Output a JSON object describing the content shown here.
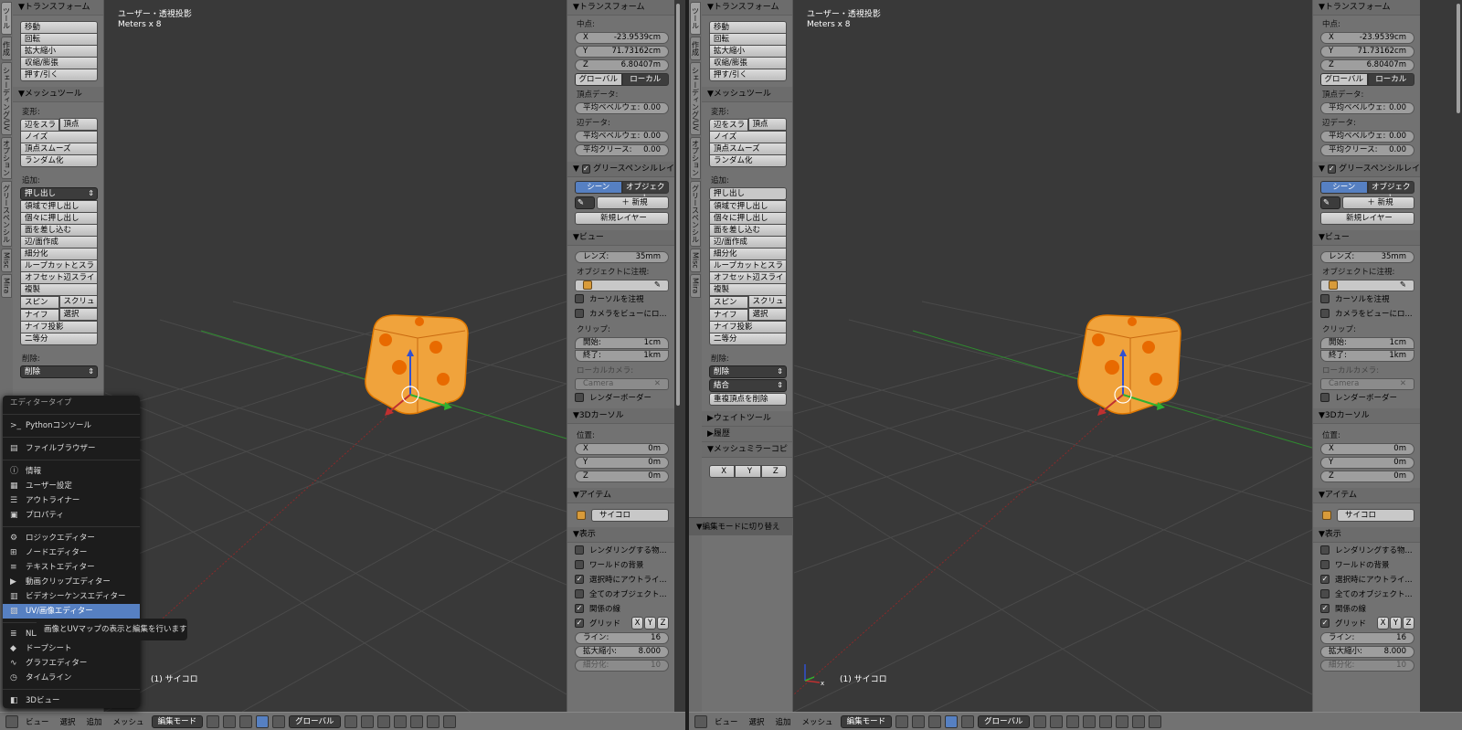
{
  "left": {
    "tabs": [
      "ツール",
      "作成",
      "シェーディング/UV",
      "オプション",
      "グリースペンシル",
      "Misc",
      "Mira"
    ],
    "viewport": {
      "title": "ユーザー・透視投影",
      "sub": "Meters x 8",
      "object": "(1) サイコロ"
    },
    "transform_title": "▼トランスフォーム",
    "transform_btns": [
      "移動",
      "回転",
      "拡大縮小",
      "収縮/膨張",
      "押す/引く"
    ],
    "meshtools_title": "▼メッシュツール",
    "deform_label": "変形:",
    "deform_row": [
      "辺をスラ",
      "頂点"
    ],
    "deform_btns": [
      "ノイズ",
      "頂点スムーズ",
      "ランダム化"
    ],
    "add_label": "追加:",
    "extrude": "押し出し",
    "add_btns": [
      "領域で押し出し",
      "個々に押し出し",
      "面を差し込む",
      "辺/面作成",
      "細分化",
      "ループカットとスラ",
      "オフセット辺スライド",
      "複製"
    ],
    "spin_row": [
      "スピン",
      "スクリュ"
    ],
    "knife_row": [
      "ナイフ",
      "選択"
    ],
    "add_btns2": [
      "ナイフ投影",
      "二等分"
    ],
    "delete_label": "削除:",
    "delete": "削除"
  },
  "menu": {
    "title": "エディタータイプ",
    "items": [
      {
        "label": "Pythonコンソール",
        "icon": ">_"
      },
      {
        "label": "ファイルブラウザー",
        "icon": "▤"
      },
      {
        "label": "情報",
        "icon": "ⓘ"
      },
      {
        "label": "ユーザー設定",
        "icon": "▦"
      },
      {
        "label": "アウトライナー",
        "icon": "☰"
      },
      {
        "label": "プロパティ",
        "icon": "▣"
      },
      {
        "label": "ロジックエディター",
        "icon": "⚙"
      },
      {
        "label": "ノードエディター",
        "icon": "⊞"
      },
      {
        "label": "テキストエディター",
        "icon": "≡"
      },
      {
        "label": "動画クリップエディター",
        "icon": "▶"
      },
      {
        "label": "ビデオシーケンスエディター",
        "icon": "▥"
      },
      {
        "label": "UV/画像エディター",
        "icon": "▨"
      },
      {
        "label": "NLA",
        "icon": "≣"
      },
      {
        "label": "ドープシート",
        "icon": "◆"
      },
      {
        "label": "グラフエディター",
        "icon": "∿"
      },
      {
        "label": "タイムライン",
        "icon": "◷"
      },
      {
        "label": "3Dビュー",
        "icon": "◧"
      }
    ],
    "tooltip": "画像とUVマップの表示と編集を行います"
  },
  "npanel": {
    "transform_title": "▼トランスフォーム",
    "median_label": "中点:",
    "x": "-23.9539cm",
    "y": "71.73162cm",
    "z": "6.80407m",
    "global": "グローバル",
    "local": "ローカル",
    "vertex_data": "頂点データ:",
    "mean_bevel": "平均ベベルウェ:",
    "mean_bevel_val": "0.00",
    "edge_data": "辺データ:",
    "mean_crease": "平均クリース:",
    "mean_crease_val": "0.00",
    "gpencil_title": "グリースペンシルレイ",
    "scene": "シーン",
    "object": "オブジェクト",
    "new": "新規",
    "new_layer": "新規レイヤー",
    "view_title": "▼ビュー",
    "lens": "レンズ:",
    "lens_val": "35mm",
    "look_at": "オブジェクトに注視:",
    "lock_cursor": "カーソルを注視",
    "lock_camera": "カメラをビューにロ...",
    "clip": "クリップ:",
    "clip_start": "開始:",
    "clip_start_val": "1cm",
    "clip_end": "終了:",
    "clip_end_val": "1km",
    "local_camera": "ローカルカメラ:",
    "camera": "Camera",
    "render_border": "レンダーボーダー",
    "cursor_title": "▼3Dカーソル",
    "location": "位置:",
    "cx": "0m",
    "cy": "0m",
    "cz": "0m",
    "item_title": "▼アイテム",
    "item_name": "サイコロ",
    "display_title": "▼表示",
    "only_render": "レンダリングする物...",
    "world_bg": "ワールドの背景",
    "outline_sel": "選択時にアウトライ...",
    "all_obj": "全てのオブジェクト...",
    "rel_lines": "関係の線",
    "grid": "グリッド",
    "lines": "ライン:",
    "lines_val": "16",
    "scale": "拡大縮小:",
    "scale_val": "8.000",
    "subdiv": "細分化:",
    "subdiv_val": "10",
    "xyz": [
      "X",
      "Y",
      "Z"
    ]
  },
  "right": {
    "merge": "結合",
    "remove_doubles": "重複頂点を削除",
    "weight_tools": "▶ウェイトツール",
    "history": "▶履歴",
    "mesh_mirror": "▼メッシュミラーコピ",
    "edit_toggle": "▼編集モードに切り替え"
  },
  "header": {
    "view": "ビュー",
    "select": "選択",
    "add": "追加",
    "mesh": "メッシュ",
    "mode": "編集モード",
    "orient": "グローバル"
  },
  "axis": {
    "x": "X",
    "y": "Y",
    "z": "Z"
  },
  "colors": {
    "accent": "#5680c2",
    "cube": "#f0a33c",
    "x_axis": "#c03030",
    "y_axis": "#30b030",
    "z_axis": "#3050d0"
  }
}
